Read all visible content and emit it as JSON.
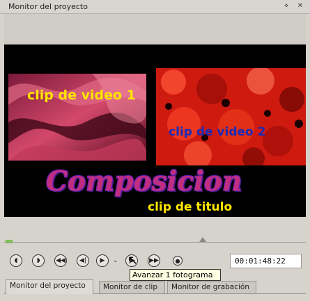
{
  "window": {
    "title": "Monitor del proyecto",
    "float_icon": "float-icon",
    "close_icon": "close-icon",
    "float_glyph": "⋄",
    "close_glyph": "✕"
  },
  "preview": {
    "clip1_label": "clip de video 1",
    "clip2_label": "clip de video 2",
    "title_text": "Composicion",
    "title_clip_label": "clip de titulo",
    "colors": {
      "background": "#000000",
      "clip1_text": "#ffe500",
      "clip2_text": "#1a2bb8",
      "title_fill": "#c12e80",
      "title_clip_text": "#ffe500"
    }
  },
  "timeline": {
    "progress_color": "#7cc24f"
  },
  "controls": {
    "buttons": [
      {
        "name": "seek-start-icon",
        "glyph": "◖"
      },
      {
        "name": "mark-in-icon",
        "glyph": "◗"
      },
      {
        "name": "rewind-icon",
        "glyph": "◀◀"
      },
      {
        "name": "previous-frame-icon",
        "glyph": "◀|"
      },
      {
        "name": "play-icon",
        "glyph": "▶"
      },
      {
        "name": "next-frame-icon",
        "glyph": "|▶"
      },
      {
        "name": "fast-forward-icon",
        "glyph": "▶▶"
      },
      {
        "name": "loop-icon",
        "glyph": "●"
      }
    ],
    "play_dropdown_glyph": "⌄",
    "timecode": "00:01:48:22",
    "tooltip": "Avanzar 1 fotograma"
  },
  "tabs": [
    {
      "label": "Monitor del proyecto",
      "active": true
    },
    {
      "label": "Monitor de clip",
      "active": false
    },
    {
      "label": "Monitor de grabación",
      "active": false
    }
  ]
}
